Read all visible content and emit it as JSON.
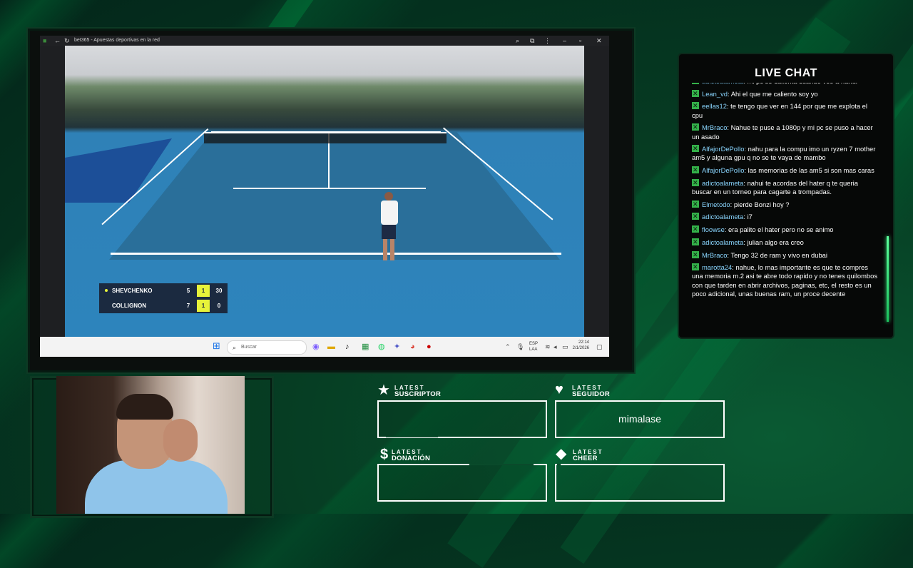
{
  "browser": {
    "tab_title": "bet365 - Apuestas deportivas en la red",
    "search_placeholder": "Buscar",
    "tray_lang_top": "ESP",
    "tray_lang_bottom": "LAA",
    "clock_time": "22:14",
    "clock_date": "2/1/2026"
  },
  "scoreboard": {
    "players": [
      {
        "name": "SHEVCHENKO",
        "set": "5",
        "game": "1",
        "points": "30",
        "serving": true
      },
      {
        "name": "COLLIGNON",
        "set": "7",
        "game": "1",
        "points": "0",
        "serving": false
      }
    ]
  },
  "chat": {
    "title": "LIVE CHAT",
    "messages": [
      {
        "user": "adictoalameta",
        "text": "mi pc se calienta cuando veo a nahui"
      },
      {
        "user": "Lean_vd",
        "text": "Ahi el que me caliento soy yo"
      },
      {
        "user": "eellas12",
        "text": "te tengo que ver en 144 por que me explota el cpu"
      },
      {
        "user": "MrBraco",
        "text": "Nahue te puse a 1080p y mi pc se puso a hacer un asado"
      },
      {
        "user": "AlfajorDePollo",
        "text": "nahu para la compu imo un ryzen 7 mother am5 y alguna gpu q no se te vaya de mambo"
      },
      {
        "user": "AlfajorDePollo",
        "text": "las memorias de las am5 si son mas caras"
      },
      {
        "user": "adictoalameta",
        "text": "nahui te acordas del hater q te queria buscar en un torneo para cagarte a trompadas."
      },
      {
        "user": "Elmetodo",
        "text": "pierde Bonzi hoy ?"
      },
      {
        "user": "adictoalameta",
        "text": "i7"
      },
      {
        "user": "floowse",
        "text": "era palito el hater pero no se animo"
      },
      {
        "user": "adictoalameta",
        "text": "julian algo era creo"
      },
      {
        "user": "MrBraco",
        "text": "Tengo 32 de ram y vivo en dubai"
      },
      {
        "user": "marotta24",
        "text": "nahue, lo mas importante es que te compres una memoria m.2 asi te abre todo rapido y no tenes quilombos con que tarden en abrir archivos, paginas, etc, el resto es un poco adicional, unas buenas ram, un proce decente"
      }
    ]
  },
  "latest": {
    "suscriptor": {
      "small": "LATEST",
      "big": "SUSCRIPTOR",
      "icon": "star-icon",
      "value": ""
    },
    "seguidor": {
      "small": "LATEST",
      "big": "SEGUIDOR",
      "icon": "heart-icon",
      "value": "mimalase"
    },
    "donacion": {
      "small": "LATEST",
      "big": "DONACIÓN",
      "icon": "dollar-icon",
      "value": ""
    },
    "cheer": {
      "small": "LATEST",
      "big": "CHEER",
      "icon": "diamond-icon",
      "value": ""
    }
  },
  "colors": {
    "accent": "#34b24a",
    "username": "#8ad6ff",
    "score_highlight": "#e7f23a"
  }
}
